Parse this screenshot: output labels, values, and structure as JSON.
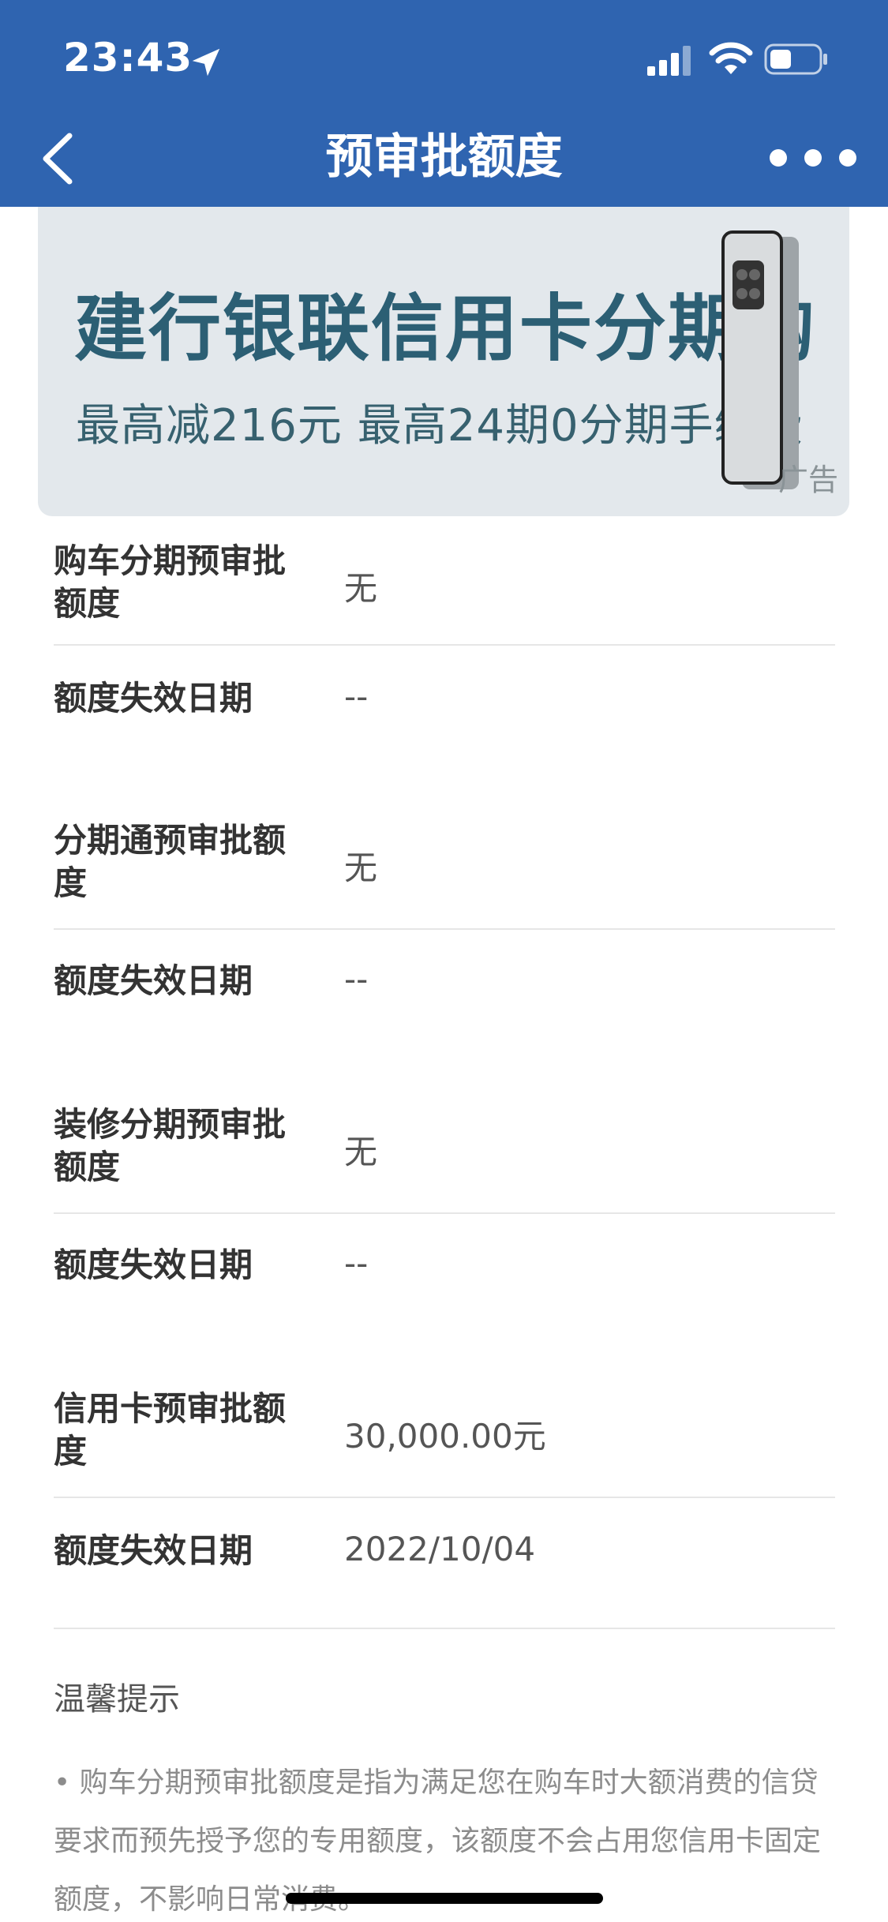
{
  "status_bar": {
    "time": "23:43"
  },
  "nav": {
    "title": "预审批额度"
  },
  "banner": {
    "title": "建行银联信用卡分期购",
    "subtitle": "最高减216元 最高24期0分期手续费",
    "ad_label": "广告"
  },
  "rows": [
    {
      "label": "购车分期预审批额度",
      "value": "无"
    },
    {
      "label": "额度失效日期",
      "value": "--"
    },
    {
      "label": "分期通预审批额度",
      "value": "无"
    },
    {
      "label": "额度失效日期",
      "value": "--"
    },
    {
      "label": "装修分期预审批额度",
      "value": "无"
    },
    {
      "label": "额度失效日期",
      "value": "--"
    },
    {
      "label": "信用卡预审批额度",
      "value": "30,000.00元"
    },
    {
      "label": "额度失效日期",
      "value": "2022/10/04"
    }
  ],
  "tips": {
    "title": "温馨提示",
    "text": "• 购车分期预审批额度是指为满足您在购车时大额消费的信贷要求而预先授予您的专用额度，该额度不会占用您信用卡固定额度，不影响日常消费。"
  },
  "colors": {
    "header_bg": "#2f64b0",
    "banner_bg": "#e3e8ec",
    "banner_text": "#2c5f74"
  }
}
